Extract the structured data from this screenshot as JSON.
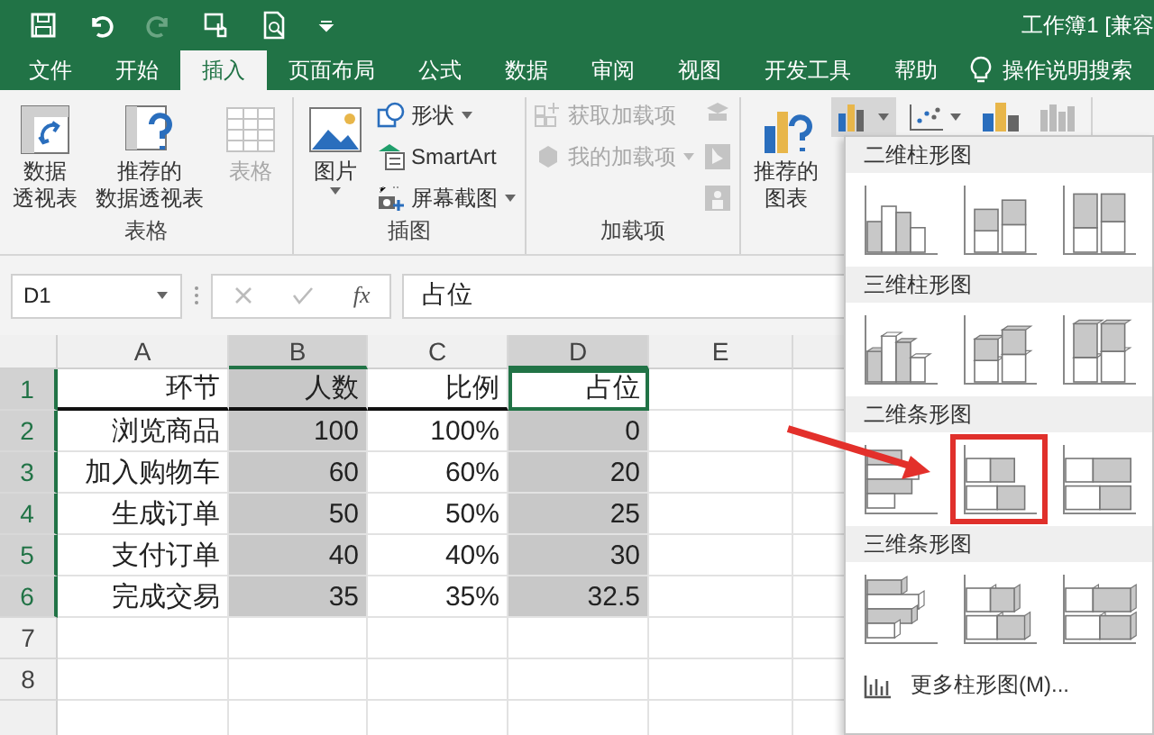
{
  "quick_access": [
    {
      "kind": "save",
      "disabled": false
    },
    {
      "kind": "undo",
      "disabled": false
    },
    {
      "kind": "redo",
      "disabled": true
    },
    {
      "kind": "touch",
      "disabled": false
    },
    {
      "kind": "preview",
      "disabled": false
    },
    {
      "kind": "customize",
      "disabled": false
    }
  ],
  "window": {
    "title": "工作簿1  [兼容"
  },
  "tabs": [
    {
      "label": "文件",
      "selected": false
    },
    {
      "label": "开始",
      "selected": false
    },
    {
      "label": "插入",
      "selected": true
    },
    {
      "label": "页面布局",
      "selected": false
    },
    {
      "label": "公式",
      "selected": false
    },
    {
      "label": "数据",
      "selected": false
    },
    {
      "label": "审阅",
      "selected": false
    },
    {
      "label": "视图",
      "selected": false
    },
    {
      "label": "开发工具",
      "selected": false
    },
    {
      "label": "帮助",
      "selected": false
    }
  ],
  "tell_me": "操作说明搜索",
  "ribbon_groups": [
    {
      "label": "表格",
      "items": [
        {
          "kind": "large",
          "lines": [
            "数据",
            "透视表"
          ],
          "disabled": false,
          "caret": false
        },
        {
          "kind": "large",
          "lines": [
            "推荐的",
            "数据透视表"
          ],
          "disabled": false,
          "caret": false
        },
        {
          "kind": "large",
          "lines": [
            "表格"
          ],
          "disabled": true,
          "caret": false
        }
      ]
    },
    {
      "label": "插图",
      "items": [
        {
          "kind": "large",
          "lines": [
            "图片"
          ],
          "disabled": false,
          "caret": true
        },
        {
          "kind": "small",
          "entries": [
            {
              "label": "形状",
              "disabled": false,
              "caret": true
            },
            {
              "label": "SmartArt",
              "disabled": false,
              "caret": false
            },
            {
              "label": "屏幕截图",
              "disabled": false,
              "caret": true
            }
          ]
        }
      ]
    },
    {
      "label": "加载项",
      "items": [
        {
          "kind": "small",
          "entries": [
            {
              "label": "获取加载项",
              "disabled": true,
              "caret": false
            },
            {
              "label": "我的加载项",
              "disabled": true,
              "caret": true
            }
          ]
        },
        {
          "kind": "icons",
          "entries": [
            {
              "disabled": true
            },
            {
              "disabled": true
            },
            {
              "disabled": true
            }
          ]
        }
      ]
    },
    {
      "items": [
        {
          "kind": "large",
          "lines": [
            "推荐的",
            "图表"
          ],
          "disabled": false,
          "caret": false
        },
        {
          "kind": "toolbar",
          "entries": [
            {
              "open": true
            },
            {
              "open": false
            },
            {
              "open": false
            },
            {
              "open": false
            }
          ]
        }
      ]
    }
  ],
  "name_box": "D1",
  "function_button": "fx",
  "formula": "占位",
  "columns": [
    {
      "label": "A",
      "selected": false,
      "active": false
    },
    {
      "label": "B",
      "selected": true,
      "active": false
    },
    {
      "label": "C",
      "selected": false,
      "active": false
    },
    {
      "label": "D",
      "selected": true,
      "active": true
    },
    {
      "label": "E",
      "selected": false,
      "active": false
    }
  ],
  "rows": [
    {
      "number": "1",
      "selected": true,
      "active": true,
      "header": true,
      "cells": [
        "环节",
        "人数",
        "比例",
        "占位"
      ]
    },
    {
      "number": "2",
      "selected": true,
      "active": false,
      "header": false,
      "cells": [
        "浏览商品",
        "100",
        "100%",
        "0"
      ]
    },
    {
      "number": "3",
      "selected": true,
      "active": false,
      "header": false,
      "cells": [
        "加入购物车",
        "60",
        "60%",
        "20"
      ]
    },
    {
      "number": "4",
      "selected": true,
      "active": false,
      "header": false,
      "cells": [
        "生成订单",
        "50",
        "50%",
        "25"
      ]
    },
    {
      "number": "5",
      "selected": true,
      "active": false,
      "header": false,
      "cells": [
        "支付订单",
        "40",
        "40%",
        "30"
      ]
    },
    {
      "number": "6",
      "selected": true,
      "active": false,
      "header": false,
      "cells": [
        "完成交易",
        "35",
        "35%",
        "32.5"
      ]
    },
    {
      "number": "7",
      "selected": false,
      "active": false,
      "cells": []
    },
    {
      "number": "8",
      "selected": false,
      "active": false,
      "cells": []
    }
  ],
  "chart_menu": {
    "sections": [
      {
        "title": "二维柱形图",
        "kind": "column",
        "options": [
          {
            "kind": "clustered",
            "highlighted": false
          },
          {
            "kind": "stacked",
            "highlighted": false
          },
          {
            "kind": "percent",
            "highlighted": false
          }
        ]
      },
      {
        "title": "三维柱形图",
        "kind": "column-3d",
        "options": [
          {
            "kind": "clustered",
            "highlighted": false
          },
          {
            "kind": "stacked",
            "highlighted": false
          },
          {
            "kind": "percent",
            "highlighted": false
          }
        ]
      },
      {
        "title": "二维条形图",
        "kind": "bar",
        "options": [
          {
            "kind": "clustered",
            "highlighted": false
          },
          {
            "kind": "stacked",
            "highlighted": true
          },
          {
            "kind": "percent",
            "highlighted": false
          }
        ]
      },
      {
        "title": "三维条形图",
        "kind": "bar-3d",
        "options": [
          {
            "kind": "clustered",
            "highlighted": false
          },
          {
            "kind": "stacked",
            "highlighted": false
          },
          {
            "kind": "percent",
            "highlighted": false
          }
        ]
      }
    ],
    "more": "更多柱形图(M)..."
  },
  "annotation": {
    "kind": "arrow"
  }
}
